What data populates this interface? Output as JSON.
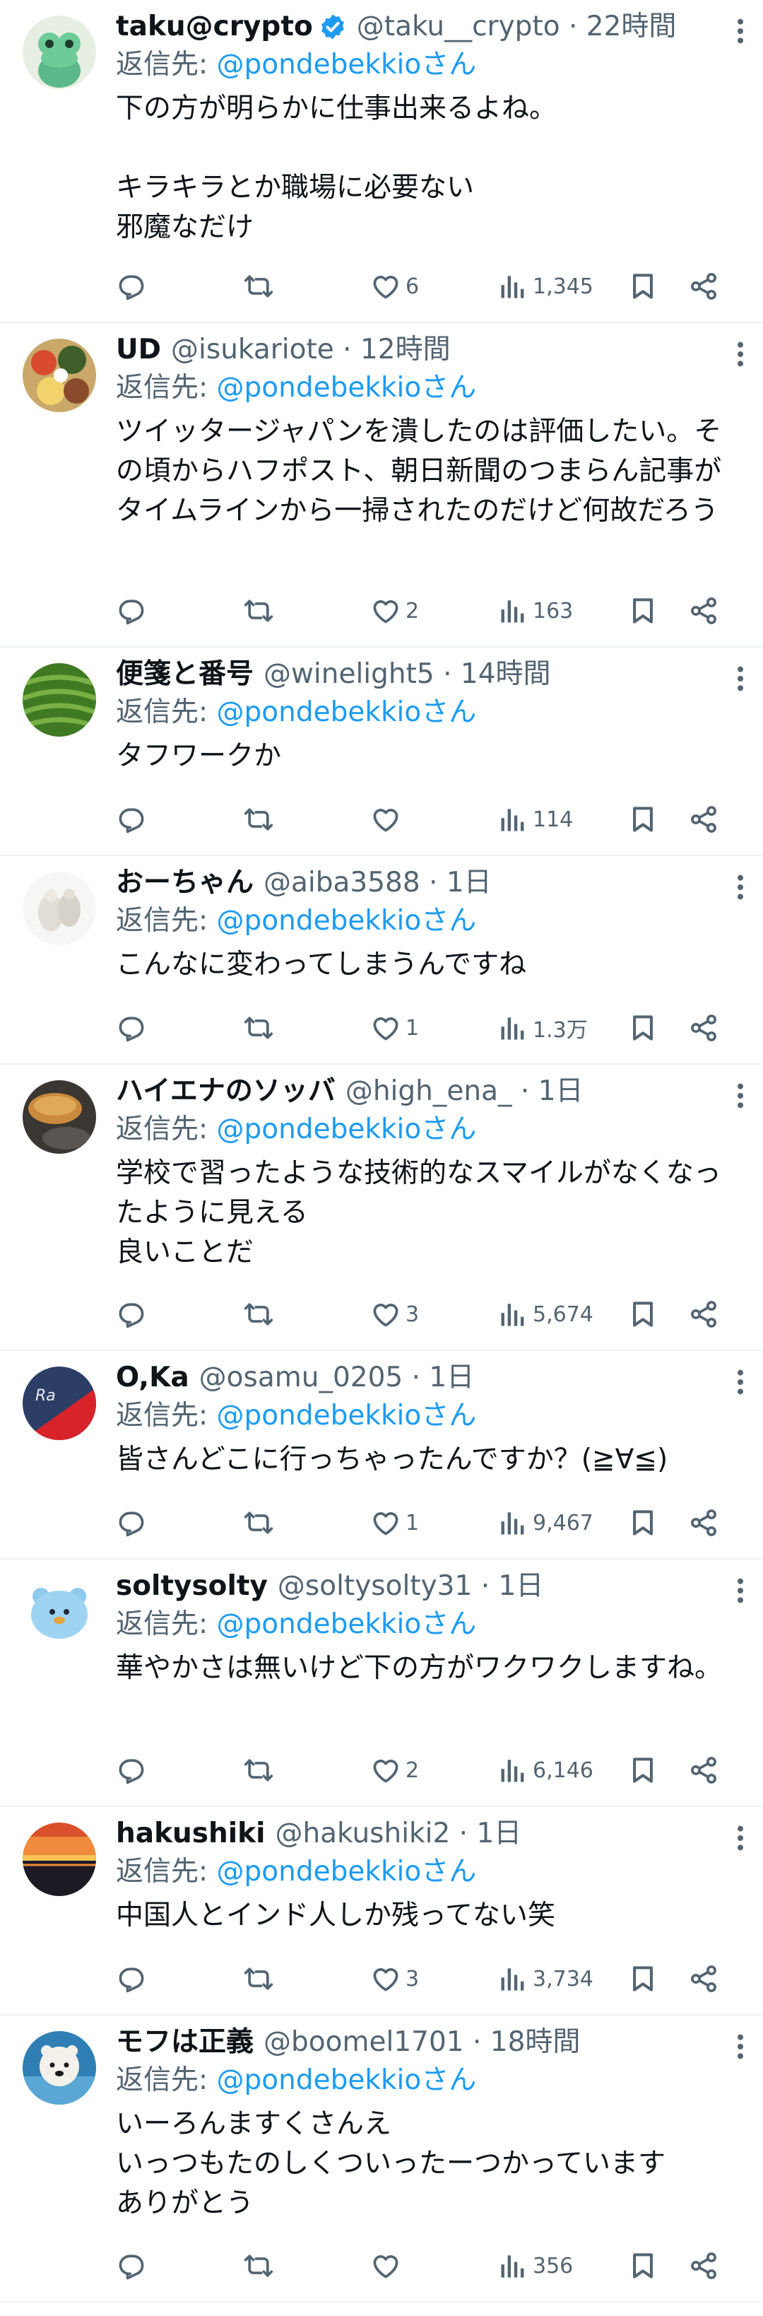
{
  "replies": [
    {
      "name": "taku@crypto",
      "verified": true,
      "handle": "@taku__crypto",
      "time": "22時間",
      "reply_prefix": "返信先: ",
      "reply_to": "@pondebekkioさん",
      "text": "下の方が明らかに仕事出来るよね。\n\nキラキラとか職場に必要ない\n邪魔なだけ",
      "likes": "6",
      "views": "1,345",
      "avatar_icon": "frog-avatar"
    },
    {
      "name": "UD",
      "verified": false,
      "handle": "@isukariote",
      "time": "12時間",
      "reply_prefix": "返信先: ",
      "reply_to": "@pondebekkioさん",
      "text": "ツイッタージャパンを潰したのは評価したい。その頃からハフポスト、朝日新聞のつまらん記事がタイムラインから一掃されたのだけど何故だろう",
      "likes": "2",
      "views": "163",
      "avatar_icon": "bento-avatar"
    },
    {
      "name": "便箋と番号",
      "verified": false,
      "handle": "@winelight5",
      "time": "14時間",
      "reply_prefix": "返信先: ",
      "reply_to": "@pondebekkioさん",
      "text": "タフワークか",
      "likes": "",
      "views": "114",
      "avatar_icon": "tea-field-avatar"
    },
    {
      "name": "おーちゃん",
      "verified": false,
      "handle": "@aiba3588",
      "time": "1日",
      "reply_prefix": "返信先: ",
      "reply_to": "@pondebekkioさん",
      "text": "こんなに変わってしまうんですね",
      "likes": "1",
      "views": "1.3万",
      "avatar_icon": "white-figure-avatar"
    },
    {
      "name": "ハイエナのソッバ",
      "verified": false,
      "handle": "@high_ena_",
      "time": "1日",
      "reply_prefix": "返信先: ",
      "reply_to": "@pondebekkioさん",
      "text": "学校で習ったような技術的なスマイルがなくなったように見える\n良いことだ",
      "likes": "3",
      "views": "5,674",
      "avatar_icon": "bread-avatar"
    },
    {
      "name": "O,Ka",
      "verified": false,
      "handle": "@osamu_0205",
      "time": "1日",
      "reply_prefix": "返信先: ",
      "reply_to": "@pondebekkioさん",
      "text": "皆さんどこに行っちゃったんですか？(≧∀≦)",
      "likes": "1",
      "views": "9,467",
      "avatar_icon": "red-team-avatar"
    },
    {
      "name": "soltysolty",
      "verified": false,
      "handle": "@soltysolty31",
      "time": "1日",
      "reply_prefix": "返信先: ",
      "reply_to": "@pondebekkioさん",
      "text": "華やかさは無いけど下の方がワクワクしますね。",
      "likes": "2",
      "views": "6,146",
      "avatar_icon": "blue-bear-avatar"
    },
    {
      "name": "hakushiki",
      "verified": false,
      "handle": "@hakushiki2",
      "time": "1日",
      "reply_prefix": "返信先: ",
      "reply_to": "@pondebekkioさん",
      "text": "中国人とインド人しか残ってない笑",
      "likes": "3",
      "views": "3,734",
      "avatar_icon": "sunset-avatar"
    },
    {
      "name": "モフは正義",
      "verified": false,
      "handle": "@boomel1701",
      "time": "18時間",
      "reply_prefix": "返信先: ",
      "reply_to": "@pondebekkioさん",
      "text": "いーろんますくさんえ\nいっつもたのしくついったーつかっています\nありがとう",
      "likes": "",
      "views": "356",
      "avatar_icon": "polar-bear-avatar"
    }
  ],
  "colors": {
    "accent": "#1d9bf0",
    "secondary_text": "#536471",
    "divider": "#eff3f4",
    "verified": "#1d9bf0"
  }
}
